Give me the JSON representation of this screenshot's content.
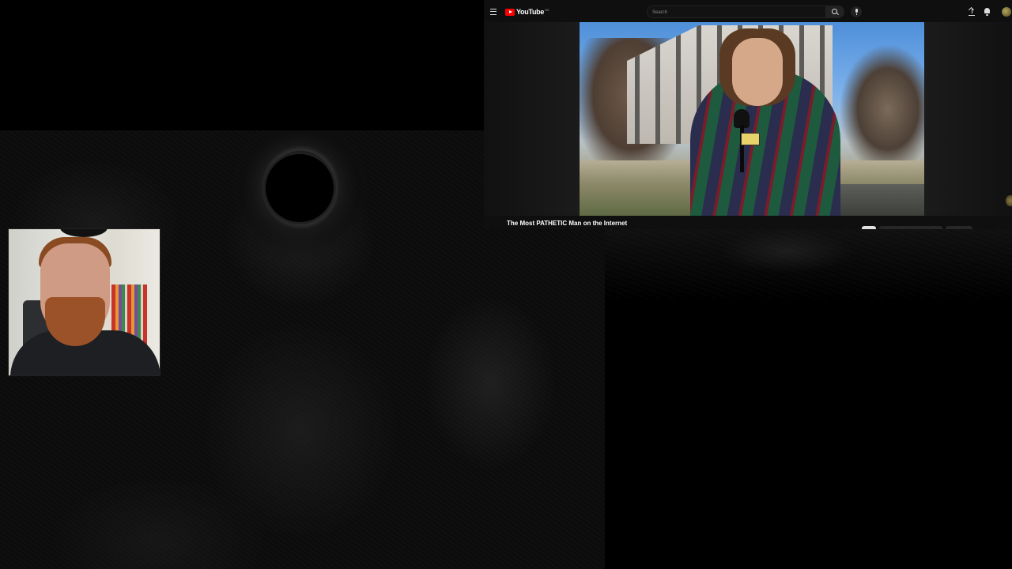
{
  "youtube": {
    "logo_text": "YouTube",
    "logo_sup": "HZ",
    "search_placeholder": "Search",
    "video_title": "The Most PATHETIC Man on the Internet",
    "brand_color": "#ff0000"
  },
  "icons": {
    "menu": "menu-icon",
    "search": "search-icon",
    "mic": "microphone-icon",
    "upload": "upload-icon",
    "notifications": "bell-icon",
    "account": "avatar"
  }
}
